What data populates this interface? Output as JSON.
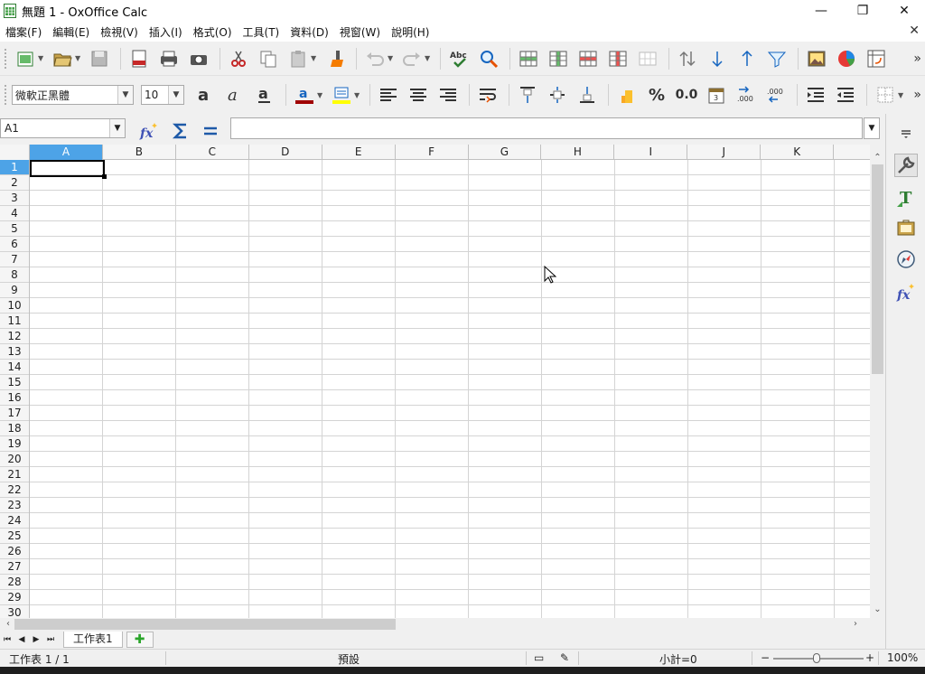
{
  "window": {
    "title": "無題 1 - OxOffice Calc",
    "minimize": "—",
    "restore": "❐",
    "close": "✕"
  },
  "menu": {
    "items": [
      "檔案(F)",
      "編輯(E)",
      "檢視(V)",
      "插入(I)",
      "格式(O)",
      "工具(T)",
      "資料(D)",
      "視窗(W)",
      "說明(H)"
    ],
    "close_doc": "✕"
  },
  "format_toolbar": {
    "font_name": "微軟正黑體",
    "font_size": "10",
    "percent": "%",
    "number": "0.0"
  },
  "formula_bar": {
    "name_box": "A1",
    "formula": ""
  },
  "grid": {
    "columns": [
      "A",
      "B",
      "C",
      "D",
      "E",
      "F",
      "G",
      "H",
      "I",
      "J",
      "K"
    ],
    "rows": [
      "1",
      "2",
      "3",
      "4",
      "5",
      "6",
      "7",
      "8",
      "9",
      "10",
      "11",
      "12",
      "13",
      "14",
      "15",
      "16",
      "17",
      "18",
      "19",
      "20",
      "21",
      "22",
      "23",
      "24",
      "25",
      "26",
      "27",
      "28",
      "29",
      "30"
    ],
    "selected_column": "A",
    "selected_row": "1"
  },
  "sheets": {
    "tabs": [
      "工作表1"
    ],
    "add": "✚"
  },
  "status": {
    "sheet_info": "工作表 1 / 1",
    "page_style": "預設",
    "sum": "小計=0",
    "zoom_minus": "−",
    "zoom_plus": "+",
    "zoom": "100%"
  },
  "colors": {
    "accent": "#4da3e7",
    "font_color": "#a00000",
    "highlight": "#ffff00"
  }
}
